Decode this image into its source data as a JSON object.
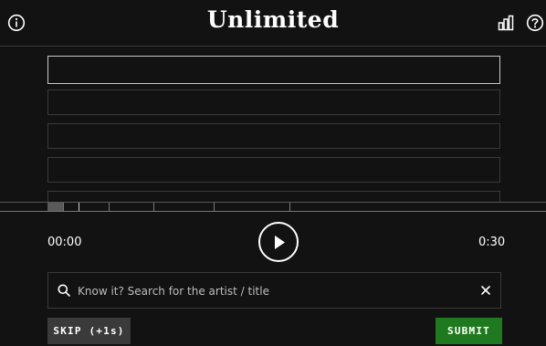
{
  "header": {
    "title": "Unlimited",
    "icons": {
      "left": "info-icon",
      "stats": "stats-icon",
      "help": "help-icon"
    }
  },
  "guesses": [
    "",
    "",
    "",
    "",
    ""
  ],
  "player": {
    "time_current": "00:00",
    "time_total": "0:30",
    "progress_fraction": 0
  },
  "search": {
    "placeholder": "Know it? Search for the artist / title",
    "value": ""
  },
  "actions": {
    "skip_label": "SKIP (+1s)",
    "submit_label": "SUBMIT"
  },
  "colors": {
    "background": "#121212",
    "submit": "#1f7a1f",
    "skip": "#3a3a3a"
  }
}
